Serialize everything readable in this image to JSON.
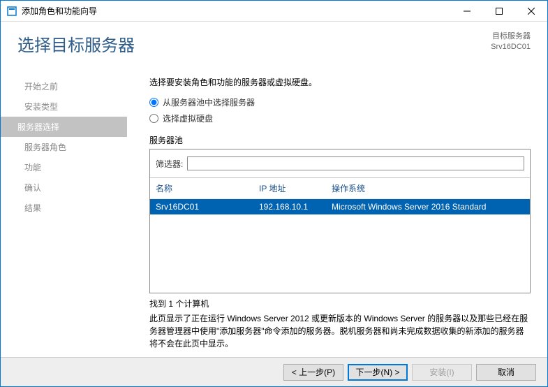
{
  "window": {
    "title": "添加角色和功能向导"
  },
  "header": {
    "title": "选择目标服务器",
    "dest_label": "目标服务器",
    "dest_value": "Srv16DC01"
  },
  "sidebar": {
    "items": [
      {
        "label": "开始之前"
      },
      {
        "label": "安装类型"
      },
      {
        "label": "服务器选择"
      },
      {
        "label": "服务器角色"
      },
      {
        "label": "功能"
      },
      {
        "label": "确认"
      },
      {
        "label": "结果"
      }
    ],
    "active_index": 2
  },
  "content": {
    "instruction": "选择要安装角色和功能的服务器或虚拟硬盘。",
    "radio_pool": "从服务器池中选择服务器",
    "radio_vhd": "选择虚拟硬盘",
    "pool_label": "服务器池",
    "filter_label": "筛选器:",
    "filter_value": "",
    "columns": {
      "name": "名称",
      "ip": "IP 地址",
      "os": "操作系统"
    },
    "rows": [
      {
        "name": "Srv16DC01",
        "ip": "192.168.10.1",
        "os": "Microsoft Windows Server 2016 Standard"
      }
    ],
    "found": "找到 1 个计算机",
    "description": "此页显示了正在运行 Windows Server 2012 或更新版本的 Windows Server 的服务器以及那些已经在服务器管理器中使用\"添加服务器\"命令添加的服务器。脱机服务器和尚未完成数据收集的新添加的服务器将不会在此页中显示。"
  },
  "footer": {
    "prev": "< 上一步(P)",
    "next": "下一步(N) >",
    "install": "安装(I)",
    "cancel": "取消"
  }
}
